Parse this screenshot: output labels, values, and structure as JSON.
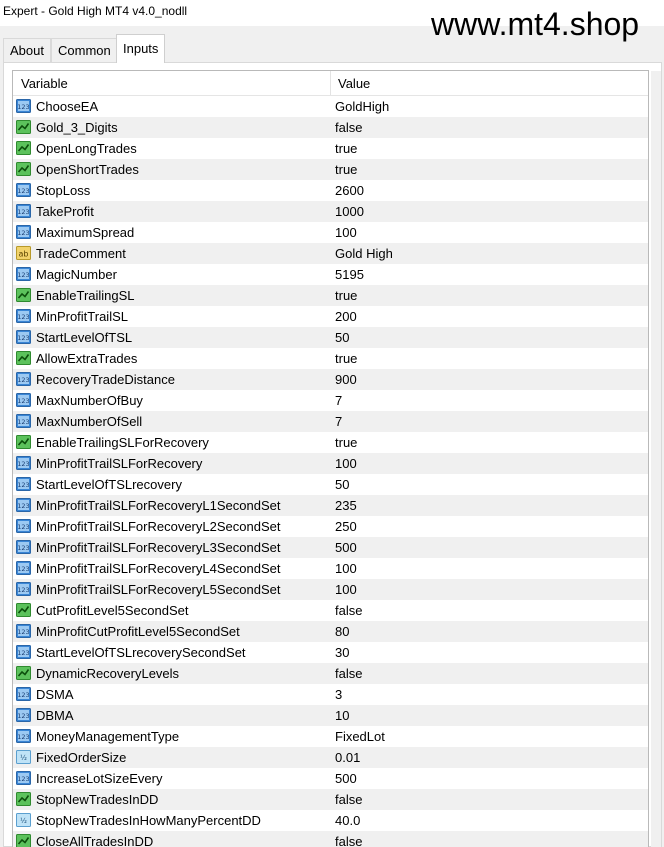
{
  "window": {
    "title": "Expert - Gold High MT4 v4.0_nodll"
  },
  "watermark": "www.mt4.shop",
  "tabs": [
    {
      "label": "About",
      "active": false
    },
    {
      "label": "Common",
      "active": false
    },
    {
      "label": "Inputs",
      "active": true
    }
  ],
  "grid": {
    "columns": {
      "variable": "Variable",
      "value": "Value"
    },
    "rows": [
      {
        "type": "int",
        "icon": "int-icon",
        "name": "ChooseEA",
        "value": "GoldHigh"
      },
      {
        "type": "bool",
        "icon": "bool-icon",
        "name": "Gold_3_Digits",
        "value": "false"
      },
      {
        "type": "bool",
        "icon": "bool-icon",
        "name": "OpenLongTrades",
        "value": "true"
      },
      {
        "type": "bool",
        "icon": "bool-icon",
        "name": "OpenShortTrades",
        "value": "true"
      },
      {
        "type": "int",
        "icon": "int-icon",
        "name": "StopLoss",
        "value": "2600"
      },
      {
        "type": "int",
        "icon": "int-icon",
        "name": "TakeProfit",
        "value": "1000"
      },
      {
        "type": "int",
        "icon": "int-icon",
        "name": "MaximumSpread",
        "value": "100"
      },
      {
        "type": "string",
        "icon": "string-icon",
        "name": "TradeComment",
        "value": "Gold High"
      },
      {
        "type": "int",
        "icon": "int-icon",
        "name": "MagicNumber",
        "value": "5195"
      },
      {
        "type": "bool",
        "icon": "bool-icon",
        "name": "EnableTrailingSL",
        "value": "true"
      },
      {
        "type": "int",
        "icon": "int-icon",
        "name": "MinProfitTrailSL",
        "value": "200"
      },
      {
        "type": "int",
        "icon": "int-icon",
        "name": "StartLevelOfTSL",
        "value": "50"
      },
      {
        "type": "bool",
        "icon": "bool-icon",
        "name": "AllowExtraTrades",
        "value": "true"
      },
      {
        "type": "int",
        "icon": "int-icon",
        "name": "RecoveryTradeDistance",
        "value": "900"
      },
      {
        "type": "int",
        "icon": "int-icon",
        "name": "MaxNumberOfBuy",
        "value": "7"
      },
      {
        "type": "int",
        "icon": "int-icon",
        "name": "MaxNumberOfSell",
        "value": "7"
      },
      {
        "type": "bool",
        "icon": "bool-icon",
        "name": "EnableTrailingSLForRecovery",
        "value": "true"
      },
      {
        "type": "int",
        "icon": "int-icon",
        "name": "MinProfitTrailSLForRecovery",
        "value": "100"
      },
      {
        "type": "int",
        "icon": "int-icon",
        "name": "StartLevelOfTSLrecovery",
        "value": "50"
      },
      {
        "type": "int",
        "icon": "int-icon",
        "name": "MinProfitTrailSLForRecoveryL1SecondSet",
        "value": "235"
      },
      {
        "type": "int",
        "icon": "int-icon",
        "name": "MinProfitTrailSLForRecoveryL2SecondSet",
        "value": "250"
      },
      {
        "type": "int",
        "icon": "int-icon",
        "name": "MinProfitTrailSLForRecoveryL3SecondSet",
        "value": "500"
      },
      {
        "type": "int",
        "icon": "int-icon",
        "name": "MinProfitTrailSLForRecoveryL4SecondSet",
        "value": "100"
      },
      {
        "type": "int",
        "icon": "int-icon",
        "name": "MinProfitTrailSLForRecoveryL5SecondSet",
        "value": "100"
      },
      {
        "type": "bool",
        "icon": "bool-icon",
        "name": "CutProfitLevel5SecondSet",
        "value": "false"
      },
      {
        "type": "int",
        "icon": "int-icon",
        "name": "MinProfitCutProfitLevel5SecondSet",
        "value": "80"
      },
      {
        "type": "int",
        "icon": "int-icon",
        "name": "StartLevelOfTSLrecoverySecondSet",
        "value": "30"
      },
      {
        "type": "bool",
        "icon": "bool-icon",
        "name": "DynamicRecoveryLevels",
        "value": "false"
      },
      {
        "type": "int",
        "icon": "int-icon",
        "name": "DSMA",
        "value": "3"
      },
      {
        "type": "int",
        "icon": "int-icon",
        "name": "DBMA",
        "value": "10"
      },
      {
        "type": "int",
        "icon": "int-icon",
        "name": "MoneyManagementType",
        "value": "FixedLot"
      },
      {
        "type": "double",
        "icon": "double-icon",
        "name": "FixedOrderSize",
        "value": "0.01"
      },
      {
        "type": "int",
        "icon": "int-icon",
        "name": "IncreaseLotSizeEvery",
        "value": "500"
      },
      {
        "type": "bool",
        "icon": "bool-icon",
        "name": "StopNewTradesInDD",
        "value": "false"
      },
      {
        "type": "double",
        "icon": "double-icon",
        "name": "StopNewTradesInHowManyPercentDD",
        "value": "40.0"
      },
      {
        "type": "bool",
        "icon": "bool-icon",
        "name": "CloseAllTradesInDD",
        "value": "false"
      }
    ]
  }
}
